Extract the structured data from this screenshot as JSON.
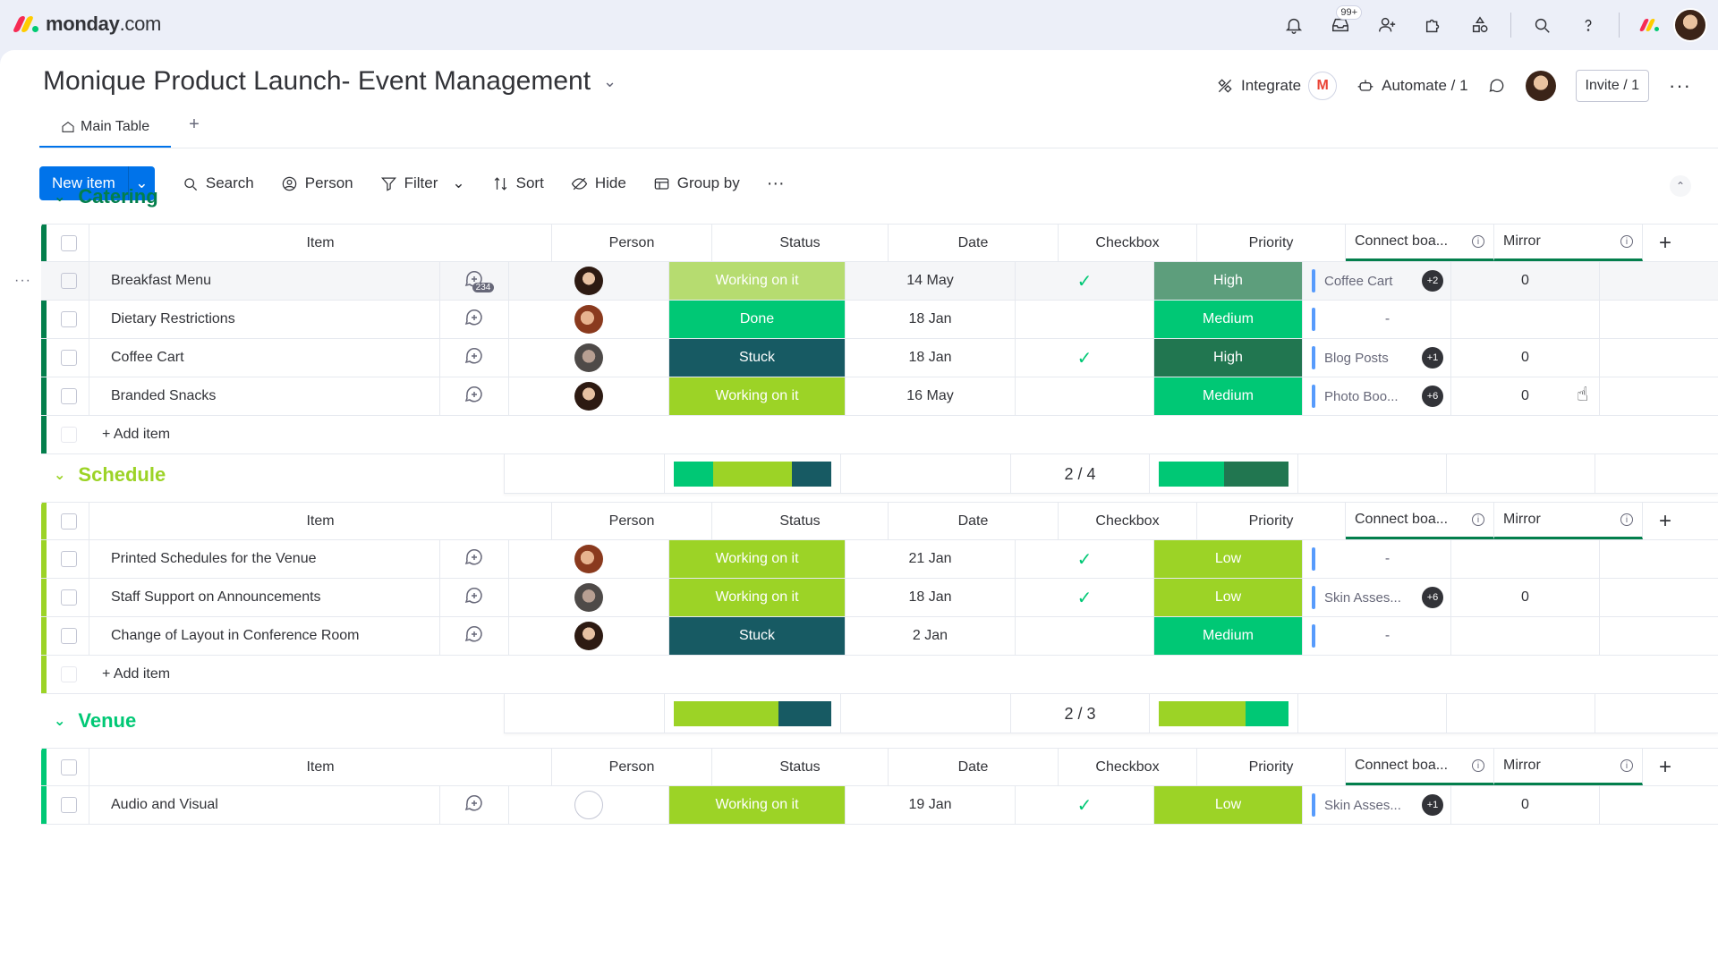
{
  "topbar": {
    "logo_text": "monday",
    "logo_suffix": ".com",
    "inbox_badge": "99+"
  },
  "board": {
    "title": "Monique Product Launch- Event Management",
    "integrate_label": "Integrate",
    "automate_label": "Automate / 1",
    "invite_label": "Invite / 1",
    "tab_main": "Main Table",
    "tab_add": "+"
  },
  "toolbar": {
    "new_item": "New item",
    "search": "Search",
    "person": "Person",
    "filter": "Filter",
    "sort": "Sort",
    "hide": "Hide",
    "group_by": "Group by"
  },
  "columns": {
    "item": "Item",
    "person": "Person",
    "status": "Status",
    "date": "Date",
    "checkbox": "Checkbox",
    "priority": "Priority",
    "connect": "Connect boa...",
    "mirror": "Mirror"
  },
  "add_item_label": "+ Add item",
  "colors": {
    "working": "#9cd326",
    "working_light": "#b6dc70",
    "done": "#00c875",
    "stuck": "#175a63",
    "high": "#217650",
    "high_light": "#5d9e7c",
    "medium": "#00c875",
    "low": "#9cd326",
    "catering_group": "#037f4c",
    "schedule_group": "#9cd326",
    "venue_group": "#00c875"
  },
  "groups": [
    {
      "name": "Catering",
      "color": "#037f4c",
      "rows": [
        {
          "item": "Breakfast Menu",
          "conv_count": "234",
          "status": "Working on it",
          "date": "14 May",
          "checked": true,
          "priority": "High",
          "connect": "Coffee Cart",
          "connect_badge": "+2",
          "mirror": "0"
        },
        {
          "item": "Dietary Restrictions",
          "status": "Done",
          "date": "18 Jan",
          "checked": false,
          "priority": "Medium",
          "connect": "-",
          "mirror": ""
        },
        {
          "item": "Coffee Cart",
          "status": "Stuck",
          "date": "18 Jan",
          "checked": true,
          "priority": "High",
          "connect": "Blog Posts",
          "connect_badge": "+1",
          "mirror": "0"
        },
        {
          "item": "Branded Snacks",
          "status": "Working on it",
          "date": "16 May",
          "checked": false,
          "priority": "Medium",
          "connect": "Photo Boo...",
          "connect_badge": "+6",
          "mirror": "0"
        }
      ],
      "summary_count": "2 / 4",
      "status_summary": [
        0.25,
        0.5,
        0.25
      ],
      "priority_summary": [
        0.5,
        0.5
      ]
    },
    {
      "name": "Schedule",
      "color": "#9cd326",
      "rows": [
        {
          "item": "Printed Schedules for the Venue",
          "status": "Working on it",
          "date": "21 Jan",
          "checked": true,
          "priority": "Low",
          "connect": "-",
          "mirror": ""
        },
        {
          "item": "Staff Support on Announcements",
          "status": "Working on it",
          "date": "18 Jan",
          "checked": true,
          "priority": "Low",
          "connect": "Skin Asses...",
          "connect_badge": "+6",
          "mirror": "0"
        },
        {
          "item": "Change of Layout in Conference Room",
          "status": "Stuck",
          "date": "2 Jan",
          "checked": false,
          "priority": "Medium",
          "connect": "-",
          "mirror": ""
        }
      ],
      "summary_count": "2 / 3",
      "status_summary": [
        0.667,
        0.333
      ],
      "priority_summary": [
        0.667,
        0.333
      ]
    },
    {
      "name": "Venue",
      "color": "#00c875",
      "rows": [
        {
          "item": "Audio and Visual",
          "status": "Working on it",
          "date": "19 Jan",
          "checked": true,
          "priority": "Low",
          "connect": "Skin Asses...",
          "connect_badge": "+1",
          "mirror": "0"
        }
      ]
    }
  ]
}
